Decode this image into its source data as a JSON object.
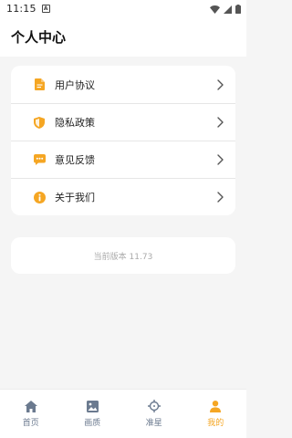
{
  "status_bar": {
    "time": "11:15"
  },
  "header": {
    "title": "个人中心"
  },
  "menu": {
    "items": [
      {
        "label": "用户协议",
        "icon": "document-icon"
      },
      {
        "label": "隐私政策",
        "icon": "shield-icon"
      },
      {
        "label": "意见反馈",
        "icon": "chat-bubble-icon"
      },
      {
        "label": "关于我们",
        "icon": "info-icon"
      }
    ]
  },
  "version": {
    "text": "当前版本 11.73"
  },
  "tabs": [
    {
      "label": "首页",
      "icon": "home-icon",
      "active": false
    },
    {
      "label": "画质",
      "icon": "image-icon",
      "active": false
    },
    {
      "label": "准星",
      "icon": "crosshair-icon",
      "active": false
    },
    {
      "label": "我的",
      "icon": "person-icon",
      "active": true
    }
  ],
  "colors": {
    "accent": "#f5a623",
    "tab_inactive": "#6b7a8f",
    "background": "#f5f5f5"
  }
}
